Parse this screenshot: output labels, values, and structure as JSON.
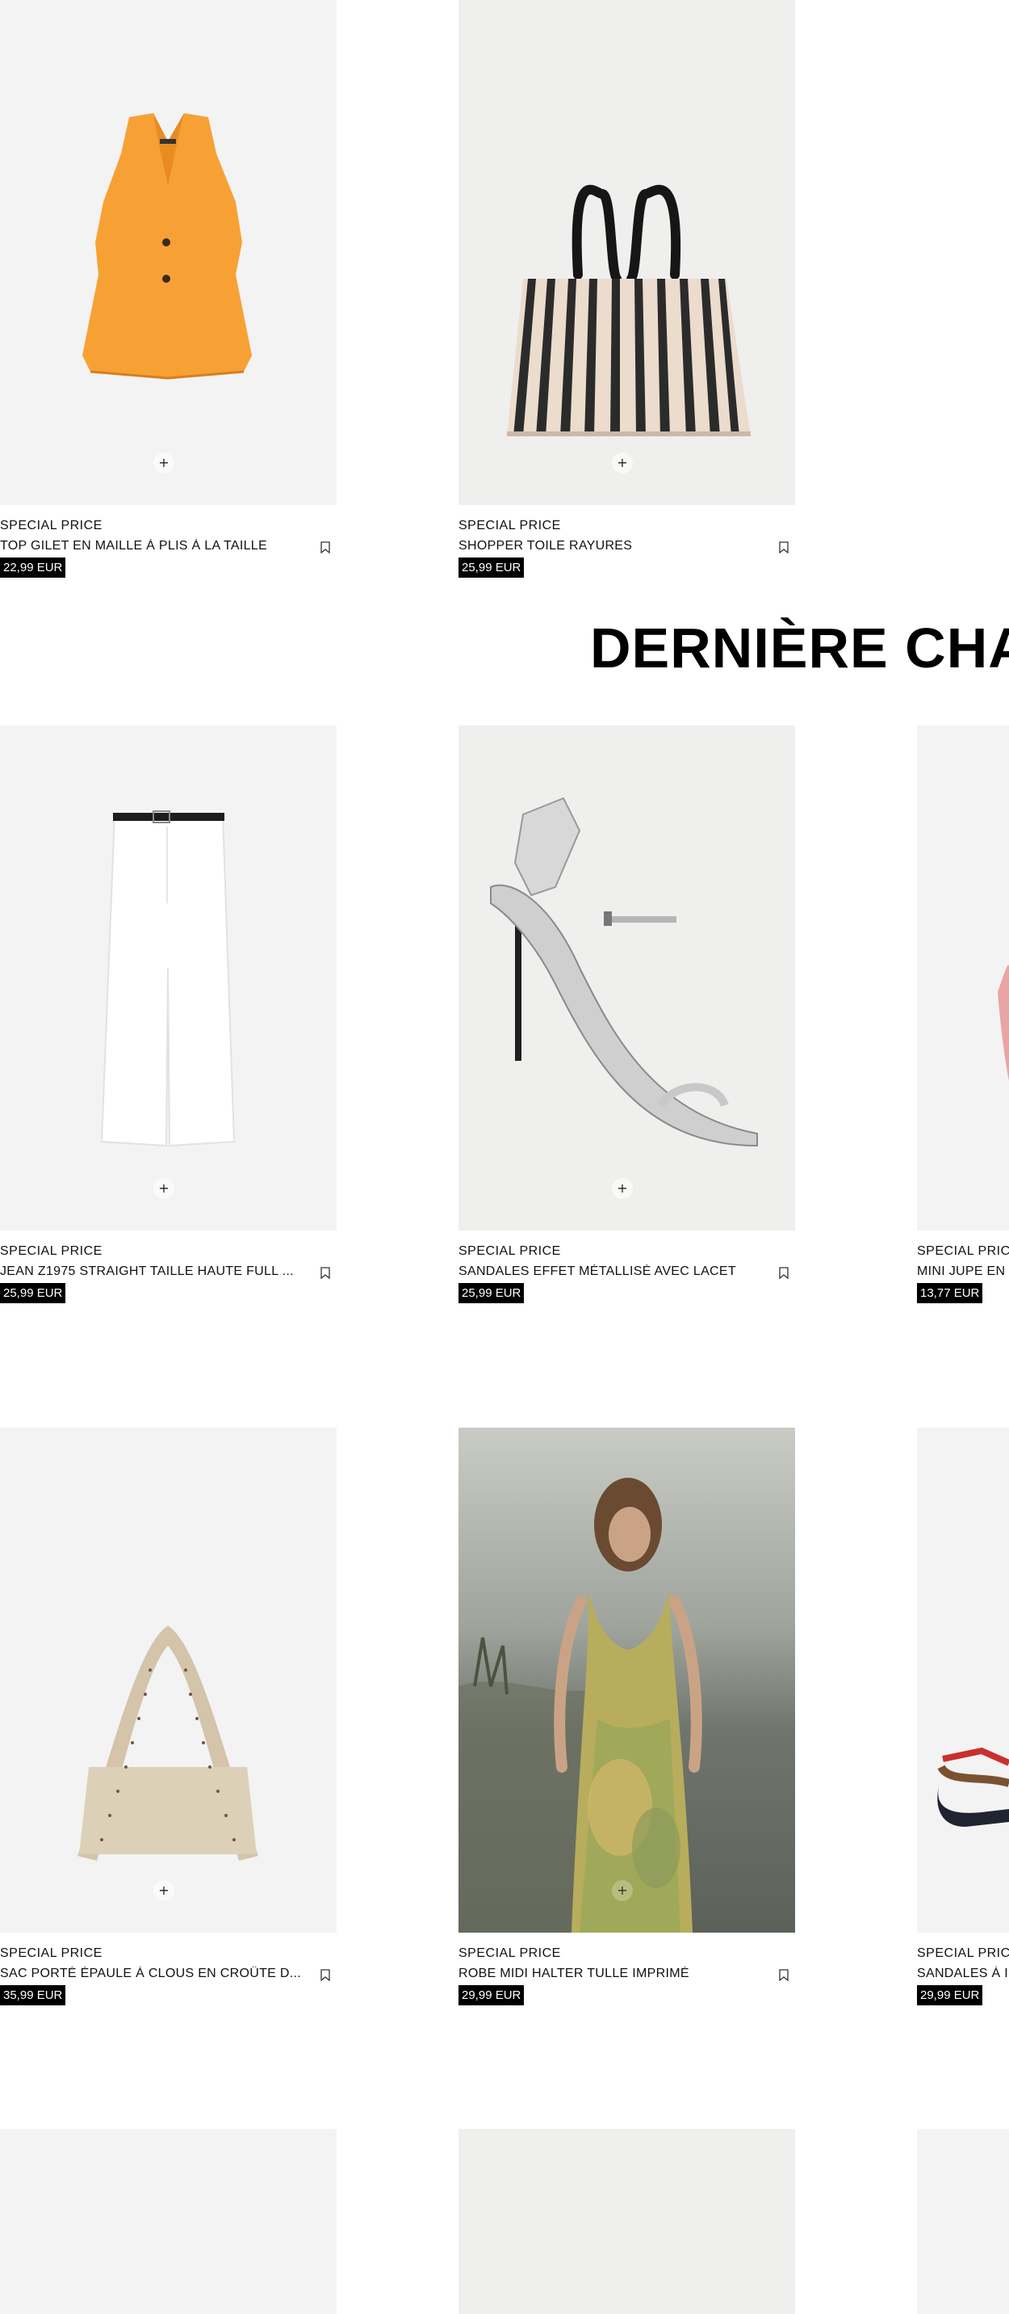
{
  "section_heading": "DERNIÈRE CHA",
  "add_symbol": "+",
  "products": [
    {
      "tag": "SPECIAL PRICE",
      "name": "TOP GILET EN MAILLE À PLIS À LA TAILLE",
      "price": "22,99 EUR",
      "image": "orange-vest"
    },
    {
      "tag": "SPECIAL PRICE",
      "name": "SHOPPER TOILE RAYURES",
      "price": "25,99 EUR",
      "image": "striped-tote"
    },
    {
      "tag": "SPECIAL PRICE",
      "name": "JEAN Z1975 STRAIGHT TAILLE HAUTE FULL ...",
      "price": "25,99 EUR",
      "image": "white-jeans"
    },
    {
      "tag": "SPECIAL PRICE",
      "name": "SANDALES EFFET MÉTALLISÉ AVEC LACET",
      "price": "25,99 EUR",
      "image": "silver-heel-sandal"
    },
    {
      "tag": "SPECIAL PRIC",
      "name": "MINI JUPE EN",
      "price": "13,77 EUR",
      "image": "mini-skirt"
    },
    {
      "tag": "SPECIAL PRICE",
      "name": "SAC PORTÉ ÉPAULE À CLOUS EN CROÛTE D...",
      "price": "35,99 EUR",
      "image": "studded-shoulder-bag"
    },
    {
      "tag": "SPECIAL PRICE",
      "name": "ROBE MIDI HALTER TULLE IMPRIMÉ",
      "price": "29,99 EUR",
      "image": "printed-halter-dress"
    },
    {
      "tag": "SPECIAL PRIC",
      "name": "SANDALES À I",
      "price": "29,99 EUR",
      "image": "flat-sandal"
    }
  ]
}
